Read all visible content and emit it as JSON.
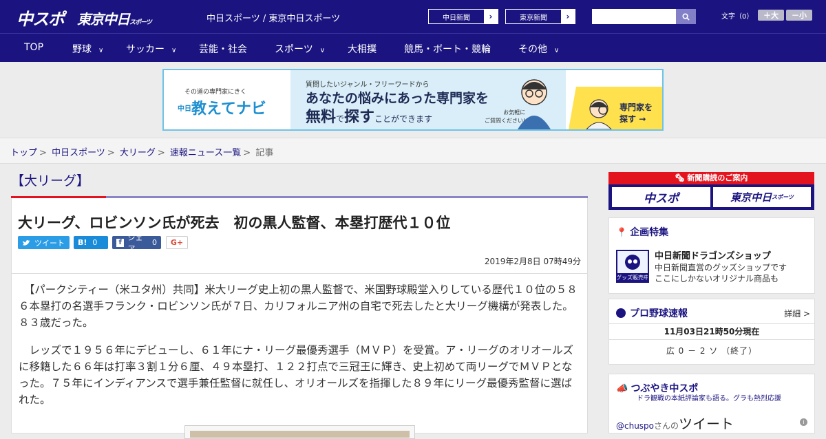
{
  "header": {
    "logo_chuspo": "中スポ",
    "logo_tokyo": "東京中日",
    "logo_tokyo_sub": "スポーツ",
    "site_title": "中日スポーツ / 東京中日スポーツ",
    "ext_links": [
      {
        "label": "中日新聞"
      },
      {
        "label": "東京新聞"
      }
    ],
    "search_placeholder": "",
    "font_size_label": "文字（0）",
    "font_larger": "＋大",
    "font_smaller": "－小"
  },
  "nav": {
    "items": [
      {
        "label": "TOP",
        "dropdown": false
      },
      {
        "label": "野球",
        "dropdown": true
      },
      {
        "label": "サッカー",
        "dropdown": true
      },
      {
        "label": "芸能・社会",
        "dropdown": false
      },
      {
        "label": "スポーツ",
        "dropdown": true
      },
      {
        "label": "大相撲",
        "dropdown": false
      },
      {
        "label": "競馬・ボート・競輪",
        "dropdown": false
      },
      {
        "label": "その他",
        "dropdown": true
      }
    ]
  },
  "banner": {
    "small": "その道の専門家にきく",
    "logo": "教えてナビ",
    "logo_prefix": "中日",
    "question": "質問したいジャンル・フリーワードから",
    "line1": "あなたの悩みにあった専門家を",
    "line2_a": "無料",
    "line2_b": "で",
    "line2_c": "探す",
    "line2_d": "ことができます",
    "note_1": "お気軽に",
    "note_2": "ご質問ください!",
    "cta_1": "専門家を",
    "cta_2": "探す"
  },
  "breadcrumb": {
    "items": [
      "トップ",
      "中日スポーツ",
      "大リーグ",
      "速報ニュース一覧"
    ],
    "current": "記事"
  },
  "article": {
    "category": "【大リーグ】",
    "headline": "大リーグ、ロビンソン氏が死去　初の黒人監督、本塁打歴代１０位",
    "share": {
      "tweet": "ツイート",
      "hatena": "B!",
      "hatena_count": "0",
      "facebook": "シェア",
      "facebook_count": "0",
      "gplus": "G+"
    },
    "date": "2019年2月8日 07時49分",
    "paragraphs": [
      "　【パークシティー（米ユタ州）共同】米大リーグ史上初の黒人監督で、米国野球殿堂入りしている歴代１０位の５８６本塁打の名選手フランク・ロビンソン氏が７日、カリフォルニア州の自宅で死去したと大リーグ機構が発表した。８３歳だった。",
      "　レッズで１９５６年にデビューし、６１年にナ・リーグ最優秀選手（ＭＶＰ）を受賞。ア・リーグのオリオールズに移籍した６６年は打率３割１分６厘、４９本塁打、１２２打点で三冠王に輝き、史上初めて両リーグでＭＶＰとなった。７５年にインディアンスで選手兼任監督に就任し、オリオールズを指揮した８９年にリーグ最優秀監督に選ばれた。"
    ]
  },
  "sidebar": {
    "subscribe": {
      "header": "新聞購読のご案内",
      "chuspo": "中スポ",
      "tokyo": "東京中日",
      "tokyo_sub": "スポーツ"
    },
    "feature": {
      "title": "企画特集",
      "shop_badge": "グッズ販売中",
      "shop_title": "中日新聞ドラゴンズショップ",
      "shop_desc_1": "中日新聞直営のグッズショップです",
      "shop_desc_2": "ここにしかないオリジナル商品も"
    },
    "baseball": {
      "title": "プロ野球速報",
      "more": "詳細 >",
      "as_of": "11月03日21時50分現在",
      "score": "広 0 － 2 ソ （終了）"
    },
    "tweets": {
      "title": "つぶやき中スポ",
      "subtitle": "ドラ観戦の本紙評論家も語る。グラも熱烈応援",
      "account": "@chuspo",
      "account_suffix": "さんの",
      "tweet_word": "ツイート"
    }
  }
}
